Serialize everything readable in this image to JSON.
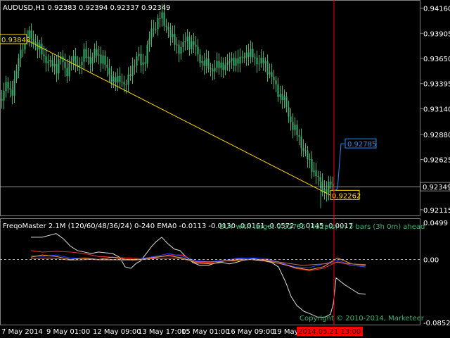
{
  "chart_data": [
    {
      "type": "candlestick",
      "symbol_header": "AUDUSD,H1  0.92383 0.92394 0.92337 0.92349",
      "ylim": [
        0.921,
        0.942
      ],
      "price_ticks": [
        "0.94160",
        "0.93905",
        "0.93650",
        "0.93395",
        "0.93140",
        "0.92880",
        "0.92625",
        "0.92370",
        "0.92115"
      ],
      "current_price": "0.92349",
      "close_path": [
        [
          0,
          0.932
        ],
        [
          5,
          0.933
        ],
        [
          10,
          0.934
        ],
        [
          16,
          0.933
        ],
        [
          22,
          0.9345
        ],
        [
          26,
          0.9365
        ],
        [
          30,
          0.9378
        ],
        [
          34,
          0.9382
        ],
        [
          38,
          0.9386
        ],
        [
          42,
          0.939
        ],
        [
          46,
          0.9385
        ],
        [
          50,
          0.938
        ],
        [
          54,
          0.9372
        ],
        [
          58,
          0.9375
        ],
        [
          62,
          0.9368
        ],
        [
          66,
          0.9362
        ],
        [
          70,
          0.9358
        ],
        [
          76,
          0.936
        ],
        [
          80,
          0.9356
        ],
        [
          86,
          0.9365
        ],
        [
          90,
          0.9358
        ],
        [
          96,
          0.9352
        ],
        [
          100,
          0.9363
        ],
        [
          104,
          0.9362
        ],
        [
          110,
          0.936
        ],
        [
          114,
          0.9358
        ],
        [
          120,
          0.937
        ],
        [
          124,
          0.9368
        ],
        [
          130,
          0.9362
        ],
        [
          134,
          0.937
        ],
        [
          140,
          0.9368
        ],
        [
          146,
          0.9365
        ],
        [
          150,
          0.9355
        ],
        [
          154,
          0.935
        ],
        [
          160,
          0.9345
        ],
        [
          166,
          0.934
        ],
        [
          172,
          0.9345
        ],
        [
          178,
          0.9338
        ],
        [
          182,
          0.9342
        ],
        [
          186,
          0.9352
        ],
        [
          190,
          0.9362
        ],
        [
          196,
          0.9368
        ],
        [
          200,
          0.9358
        ],
        [
          204,
          0.936
        ],
        [
          210,
          0.938
        ],
        [
          214,
          0.939
        ],
        [
          218,
          0.9395
        ],
        [
          222,
          0.9402
        ],
        [
          226,
          0.9408
        ],
        [
          230,
          0.9405
        ],
        [
          234,
          0.9398
        ],
        [
          238,
          0.94
        ],
        [
          242,
          0.9388
        ],
        [
          246,
          0.9382
        ],
        [
          250,
          0.9378
        ],
        [
          256,
          0.9375
        ],
        [
          262,
          0.938
        ],
        [
          266,
          0.9385
        ],
        [
          270,
          0.938
        ],
        [
          274,
          0.9382
        ],
        [
          278,
          0.9372
        ],
        [
          284,
          0.9365
        ],
        [
          290,
          0.936
        ],
        [
          296,
          0.9356
        ],
        [
          300,
          0.9354
        ],
        [
          306,
          0.9358
        ],
        [
          310,
          0.9355
        ],
        [
          316,
          0.936
        ],
        [
          322,
          0.9358
        ],
        [
          328,
          0.9362
        ],
        [
          334,
          0.9365
        ],
        [
          340,
          0.936
        ],
        [
          346,
          0.9368
        ],
        [
          350,
          0.9372
        ],
        [
          356,
          0.9368
        ],
        [
          362,
          0.9365
        ],
        [
          368,
          0.9362
        ],
        [
          374,
          0.936
        ],
        [
          378,
          0.9358
        ],
        [
          384,
          0.935
        ],
        [
          390,
          0.9338
        ],
        [
          396,
          0.933
        ],
        [
          402,
          0.9325
        ],
        [
          408,
          0.9312
        ],
        [
          414,
          0.93
        ],
        [
          420,
          0.929
        ],
        [
          426,
          0.9282
        ],
        [
          432,
          0.9272
        ],
        [
          438,
          0.926
        ],
        [
          444,
          0.9255
        ],
        [
          450,
          0.9245
        ],
        [
          456,
          0.9235
        ],
        [
          462,
          0.9232
        ],
        [
          468,
          0.9235
        ],
        [
          474,
          0.9237
        ]
      ],
      "trendline": {
        "start_label": "0.93843",
        "end_label": "0.92262",
        "start": [
          36,
          0.93843
        ],
        "end": [
          470,
          0.92262
        ]
      },
      "projection": {
        "label": "0.92785",
        "points": [
          [
            474,
            0.923
          ],
          [
            480,
            0.9233
          ],
          [
            485,
            0.92785
          ],
          [
            490,
            0.92785
          ]
        ]
      },
      "colors": {
        "candles": "#3CB371",
        "trendline": "#FFD700",
        "projection": "#1E90FF",
        "vline": "#FF0000",
        "hline": "#C0C0C0",
        "label_box": "#FFD700"
      }
    },
    {
      "type": "line",
      "header": "FreqoMaster 2.1M  (120/60/48/36/24) 0-240 EMA0 -0.0113 -0.0130 -0.0161 -0.0572 -0.0145 -0.0017",
      "forecast_text": "BUY with target 0.92785 (402pts) in 3 bars (3h 0m) ahead",
      "copyright": "Copyright © 2010-2014, Marketeer",
      "ylim": [
        -0.0852,
        0.0499
      ],
      "ticks": [
        "0.0499",
        "0.00",
        "-0.0852"
      ],
      "series": [
        {
          "color": "#DCDCDC",
          "values": [
            [
              44,
              0.03
            ],
            [
              60,
              0.03
            ],
            [
              80,
              0.035
            ],
            [
              90,
              0.028
            ],
            [
              100,
              0.018
            ],
            [
              110,
              0.012
            ],
            [
              120,
              0.01
            ],
            [
              130,
              0.008
            ],
            [
              140,
              0.01
            ],
            [
              150,
              0.009
            ],
            [
              160,
              0.008
            ],
            [
              170,
              0.003
            ],
            [
              178,
              -0.01
            ],
            [
              186,
              -0.012
            ],
            [
              194,
              -0.005
            ],
            [
              200,
              -0.002
            ],
            [
              208,
              0.008
            ],
            [
              216,
              0.018
            ],
            [
              222,
              0.024
            ],
            [
              230,
              0.03
            ],
            [
              238,
              0.022
            ],
            [
              248,
              0.014
            ],
            [
              256,
              0.012
            ],
            [
              264,
              0.004
            ],
            [
              274,
              -0.004
            ],
            [
              284,
              -0.008
            ],
            [
              296,
              -0.008
            ],
            [
              306,
              -0.005
            ],
            [
              316,
              -0.004
            ],
            [
              326,
              -0.006
            ],
            [
              336,
              -0.004
            ],
            [
              346,
              -0.001
            ],
            [
              356,
              0.0
            ],
            [
              366,
              -0.001
            ],
            [
              376,
              -0.002
            ],
            [
              386,
              -0.004
            ],
            [
              396,
              -0.01
            ],
            [
              406,
              -0.03
            ],
            [
              414,
              -0.05
            ],
            [
              422,
              -0.062
            ],
            [
              432,
              -0.07
            ],
            [
              440,
              -0.073
            ],
            [
              452,
              -0.078
            ],
            [
              462,
              -0.078
            ],
            [
              470,
              -0.074
            ],
            [
              474,
              -0.06
            ],
            [
              478,
              -0.025
            ],
            [
              482,
              -0.028
            ],
            [
              490,
              -0.034
            ],
            [
              500,
              -0.04
            ],
            [
              510,
              -0.046
            ],
            [
              520,
              -0.047
            ]
          ]
        },
        {
          "color": "#FF3030",
          "values": [
            [
              44,
              0.012
            ],
            [
              60,
              0.01
            ],
            [
              80,
              0.011
            ],
            [
              100,
              0.01
            ],
            [
              120,
              0.008
            ],
            [
              140,
              0.004
            ],
            [
              160,
              0.003
            ],
            [
              180,
              0.002
            ],
            [
              200,
              0.001
            ],
            [
              220,
              0.002
            ],
            [
              240,
              0.006
            ],
            [
              260,
              0.006
            ],
            [
              280,
              -0.004
            ],
            [
              300,
              -0.004
            ],
            [
              320,
              -0.001
            ],
            [
              340,
              0.001
            ],
            [
              360,
              0.0
            ],
            [
              380,
              0.0
            ],
            [
              400,
              -0.004
            ],
            [
              420,
              -0.012
            ],
            [
              440,
              -0.015
            ],
            [
              460,
              -0.012
            ],
            [
              480,
              -0.003
            ],
            [
              500,
              -0.008
            ],
            [
              520,
              -0.01
            ]
          ]
        },
        {
          "color": "#2040FF",
          "values": [
            [
              44,
              0.005
            ],
            [
              60,
              0.004
            ],
            [
              80,
              0.006
            ],
            [
              100,
              0.002
            ],
            [
              120,
              0.001
            ],
            [
              140,
              -0.001
            ],
            [
              160,
              -0.001
            ],
            [
              180,
              -0.001
            ],
            [
              200,
              0.001
            ],
            [
              220,
              0.004
            ],
            [
              240,
              0.008
            ],
            [
              260,
              0.004
            ],
            [
              280,
              -0.002
            ],
            [
              300,
              -0.003
            ],
            [
              320,
              -0.001
            ],
            [
              340,
              0.002
            ],
            [
              360,
              0.002
            ],
            [
              380,
              0.001
            ],
            [
              400,
              -0.005
            ],
            [
              420,
              -0.01
            ],
            [
              440,
              -0.011
            ],
            [
              460,
              -0.006
            ],
            [
              480,
              -0.001
            ],
            [
              500,
              -0.008
            ],
            [
              520,
              -0.01
            ]
          ]
        },
        {
          "color": "#FFA040",
          "values": [
            [
              44,
              0.003
            ],
            [
              60,
              0.006
            ],
            [
              80,
              0.004
            ],
            [
              100,
              0.0
            ],
            [
              120,
              0.002
            ],
            [
              140,
              0.0
            ],
            [
              160,
              0.003
            ],
            [
              180,
              0.0
            ],
            [
              200,
              0.0
            ],
            [
              220,
              0.003
            ],
            [
              240,
              0.005
            ],
            [
              260,
              0.002
            ],
            [
              280,
              -0.005
            ],
            [
              300,
              -0.006
            ],
            [
              320,
              -0.002
            ],
            [
              340,
              -0.002
            ],
            [
              360,
              0.001
            ],
            [
              380,
              -0.002
            ],
            [
              400,
              -0.006
            ],
            [
              420,
              -0.011
            ],
            [
              440,
              -0.014
            ],
            [
              460,
              -0.01
            ],
            [
              480,
              0.002
            ],
            [
              500,
              -0.006
            ],
            [
              520,
              -0.008
            ]
          ]
        },
        {
          "color": "#B07060",
          "values": [
            [
              44,
              0.001
            ],
            [
              70,
              0.002
            ],
            [
              100,
              -0.001
            ],
            [
              130,
              0.0
            ],
            [
              160,
              0.0
            ],
            [
              190,
              -0.001
            ],
            [
              220,
              0.001
            ],
            [
              250,
              0.002
            ],
            [
              280,
              -0.003
            ],
            [
              310,
              -0.003
            ],
            [
              340,
              0.0
            ],
            [
              370,
              0.0
            ],
            [
              400,
              -0.004
            ],
            [
              430,
              -0.008
            ],
            [
              460,
              -0.006
            ],
            [
              480,
              -0.004
            ],
            [
              500,
              -0.006
            ],
            [
              520,
              -0.007
            ]
          ]
        }
      ]
    }
  ],
  "time_axis": [
    "7 May 2014",
    "9 May 01:00",
    "12 May 09:00",
    "13 May 17:00",
    "15 May 01:00",
    "16 May 09:00",
    "19 May 17:00"
  ],
  "cursor_time": "2014.05.21 13:00"
}
